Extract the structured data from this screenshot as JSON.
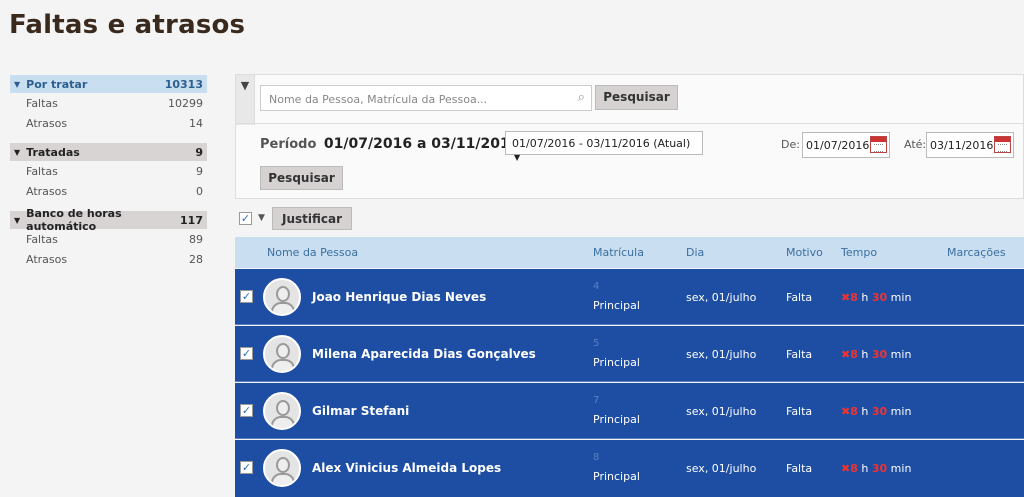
{
  "page_title": "Faltas e atrasos",
  "sidebar": {
    "groups": [
      {
        "label": "Por tratar",
        "count": "10313",
        "items": [
          {
            "label": "Faltas",
            "count": "10299"
          },
          {
            "label": "Atrasos",
            "count": "14"
          }
        ]
      },
      {
        "label": "Tratadas",
        "count": "9",
        "items": [
          {
            "label": "Faltas",
            "count": "9"
          },
          {
            "label": "Atrasos",
            "count": "0"
          }
        ]
      },
      {
        "label": "Banco de horas automático",
        "count": "117",
        "items": [
          {
            "label": "Faltas",
            "count": "89"
          },
          {
            "label": "Atrasos",
            "count": "28"
          }
        ]
      }
    ]
  },
  "filter": {
    "search_placeholder": "Nome da Pessoa, Matrícula da Pessoa...",
    "search_button": "Pesquisar",
    "periodo_label": "Período",
    "periodo_range": "01/07/2016 a 03/11/2016",
    "period_select": "01/07/2016 - 03/11/2016 (Atual)",
    "de_label": "De:",
    "de_value": "01/07/2016",
    "ate_label": "Até:",
    "ate_value": "03/11/2016",
    "pesquisar_button": "Pesquisar"
  },
  "bulk": {
    "justificar_button": "Justificar"
  },
  "table": {
    "headers": {
      "nome": "Nome da Pessoa",
      "matricula": "Matrícula",
      "dia": "Dia",
      "motivo": "Motivo",
      "tempo": "Tempo",
      "marcacoes": "Marcações"
    },
    "rows": [
      {
        "nome": "Joao Henrique Dias Neves",
        "mat_num": "4",
        "matricula": "Principal",
        "dia": "sex, 01/julho",
        "motivo": "Falta",
        "horas": "8",
        "h": "h",
        "mins": "30",
        "min": "min"
      },
      {
        "nome": "Milena Aparecida Dias Gonçalves",
        "mat_num": "5",
        "matricula": "Principal",
        "dia": "sex, 01/julho",
        "motivo": "Falta",
        "horas": "8",
        "h": "h",
        "mins": "30",
        "min": "min"
      },
      {
        "nome": "Gilmar Stefani",
        "mat_num": "7",
        "matricula": "Principal",
        "dia": "sex, 01/julho",
        "motivo": "Falta",
        "horas": "8",
        "h": "h",
        "mins": "30",
        "min": "min"
      },
      {
        "nome": "Alex Vinicius Almeida Lopes",
        "mat_num": "8",
        "matricula": "Principal",
        "dia": "sex, 01/julho",
        "motivo": "Falta",
        "horas": "8",
        "h": "h",
        "mins": "30",
        "min": "min"
      }
    ]
  },
  "colors": {
    "accent": "#1d4ea3",
    "header_bg": "#c9def0",
    "alert": "#e33333"
  }
}
